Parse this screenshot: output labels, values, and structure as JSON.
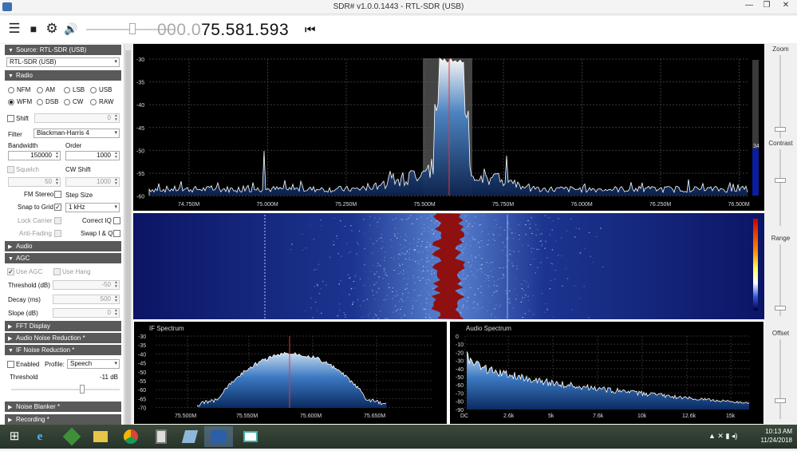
{
  "window": {
    "title": "SDR# v1.0.0.1443 - RTL-SDR (USB)",
    "min": "—",
    "max": "❐",
    "close": "✕"
  },
  "toolbar": {
    "menu_icon": "☰",
    "stop_icon": "■",
    "settings_icon": "⚙",
    "volume_icon": "🔊",
    "tune_icon": "⏮"
  },
  "frequency": {
    "dim": "000.0",
    "bright": "75.581.593"
  },
  "panel": {
    "source": {
      "header": "Source: RTL-SDR (USB)",
      "device": "RTL-SDR (USB)"
    },
    "radio": {
      "header": "Radio",
      "modes": [
        "NFM",
        "AM",
        "LSB",
        "USB",
        "WFM",
        "DSB",
        "CW",
        "RAW"
      ],
      "selected_mode": "WFM",
      "shift_label": "Shift",
      "shift_value": "0",
      "filter_label": "Filter",
      "filter_value": "Blackman-Harris 4",
      "bandwidth_label": "Bandwidth",
      "bandwidth_value": "150000",
      "order_label": "Order",
      "order_value": "1000",
      "squelch_label": "Squelch",
      "squelch_value": "50",
      "cwshift_label": "CW Shift",
      "cwshift_value": "1000",
      "fmstereo_label": "FM Stereo",
      "stepsize_label": "Step Size",
      "snap_label": "Snap to Grid",
      "step_value": "1 kHz",
      "lockcarrier_label": "Lock Carrier",
      "correctiq_label": "Correct IQ",
      "antifading_label": "Anti-Fading",
      "swapiq_label": "Swap I & Q"
    },
    "audio": {
      "header": "Audio"
    },
    "agc": {
      "header": "AGC",
      "useagc_label": "Use AGC",
      "usehang_label": "Use Hang",
      "threshold_label": "Threshold (dB)",
      "threshold_value": "-50",
      "decay_label": "Decay (ms)",
      "decay_value": "500",
      "slope_label": "Slope (dB)",
      "slope_value": "0"
    },
    "fft": {
      "header": "FFT Display"
    },
    "audio_nr": {
      "header": "Audio Noise Reduction *"
    },
    "if_nr": {
      "header": "IF Noise Reduction *",
      "enabled_label": "Enabled",
      "profile_label": "Profile:",
      "profile_value": "Speech",
      "threshold_label": "Threshold",
      "threshold_value": "-11 dB"
    },
    "noise_blanker": {
      "header": "Noise Blanker *"
    },
    "recording": {
      "header": "Recording *"
    }
  },
  "spectrum": {
    "y_ticks": [
      "-30",
      "-35",
      "-40",
      "-45",
      "-50",
      "-55",
      "-60"
    ],
    "x_ticks": [
      "74.750M",
      "75.000M",
      "75.250M",
      "75.500M",
      "75.750M",
      "76.000M",
      "76.250M",
      "76.500M"
    ],
    "level_readout": "34"
  },
  "if_spectrum": {
    "title": "IF Spectrum",
    "y_ticks": [
      "-30",
      "-35",
      "-40",
      "-45",
      "-50",
      "-55",
      "-60",
      "-65",
      "-70"
    ],
    "x_ticks": [
      "75.500M",
      "75.550M",
      "75.600M",
      "75.650M"
    ]
  },
  "audio_spectrum": {
    "title": "Audio Spectrum",
    "y_ticks": [
      "0",
      "-10",
      "-20",
      "-30",
      "-40",
      "-50",
      "-60",
      "-70",
      "-80",
      "-90"
    ],
    "x_ticks": [
      "DC",
      "2.6k",
      "5k",
      "7.6k",
      "10k",
      "12.6k",
      "15k"
    ]
  },
  "rightcol": {
    "zoom": "Zoom",
    "contrast": "Contrast",
    "range": "Range",
    "offset": "Offset"
  },
  "taskbar": {
    "time": "10:13 AM",
    "date": "11/24/2018",
    "start_icon": "⊞",
    "ie_icon": "e",
    "tray_icons": "▲ ✕ ▮ ◂)"
  },
  "colors": {
    "spectrum_bg": "#000000",
    "waterfall_bg": "#1a237e",
    "signal_red": "#d32f2f",
    "section": "#595959"
  }
}
